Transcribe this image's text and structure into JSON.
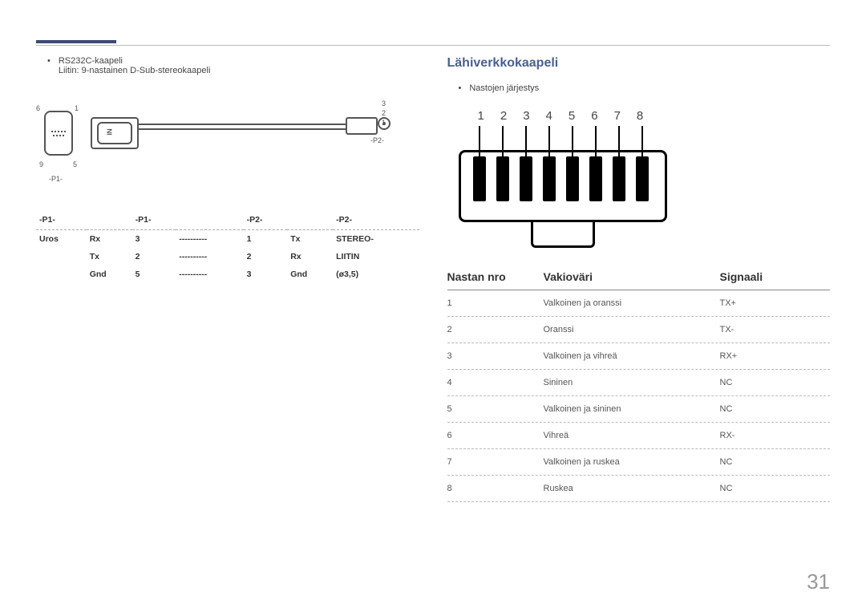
{
  "page_number": "31",
  "left": {
    "bullet1": "RS232C-kaapeli",
    "bullet1_sub": "Liitin: 9-nastainen D-Sub-stereokaapeli",
    "diagram": {
      "lbl_6": "6",
      "lbl_1": "1",
      "lbl_9": "9",
      "lbl_5": "5",
      "lbl_p1": "-P1-",
      "lbl_3": "3",
      "lbl_2": "2",
      "lbl_1r": "1",
      "lbl_p2": "-P2-",
      "in": "IN"
    },
    "pinhead": {
      "p1a": "-P1-",
      "p1b": "-P1-",
      "p2a": "-P2-",
      "p2b": "-P2-"
    },
    "pinrows": [
      {
        "a": "Uros",
        "b": "Rx",
        "c": "3",
        "d": "----------",
        "e": "1",
        "f": "Tx",
        "g": "STEREO-"
      },
      {
        "a": "",
        "b": "Tx",
        "c": "2",
        "d": "----------",
        "e": "2",
        "f": "Rx",
        "g": "LIITIN"
      },
      {
        "a": "",
        "b": "Gnd",
        "c": "5",
        "d": "----------",
        "e": "3",
        "f": "Gnd",
        "g": "(ø3,5)"
      }
    ]
  },
  "right": {
    "title": "Lähiverkkokaapeli",
    "bullet": "Nastojen järjestys",
    "rj45_nums": [
      "1",
      "2",
      "3",
      "4",
      "5",
      "6",
      "7",
      "8"
    ],
    "lan_header": {
      "c1": "Nastan nro",
      "c2": "Vakioväri",
      "c3": "Signaali"
    },
    "lan_rows": [
      {
        "n": "1",
        "color": "Valkoinen ja oranssi",
        "sig": "TX+"
      },
      {
        "n": "2",
        "color": "Oranssi",
        "sig": "TX-"
      },
      {
        "n": "3",
        "color": "Valkoinen ja vihreä",
        "sig": "RX+"
      },
      {
        "n": "4",
        "color": "Sininen",
        "sig": "NC"
      },
      {
        "n": "5",
        "color": "Valkoinen ja sininen",
        "sig": "NC"
      },
      {
        "n": "6",
        "color": "Vihreä",
        "sig": "RX-"
      },
      {
        "n": "7",
        "color": "Valkoinen ja ruskea",
        "sig": "NC"
      },
      {
        "n": "8",
        "color": "Ruskea",
        "sig": "NC"
      }
    ]
  }
}
